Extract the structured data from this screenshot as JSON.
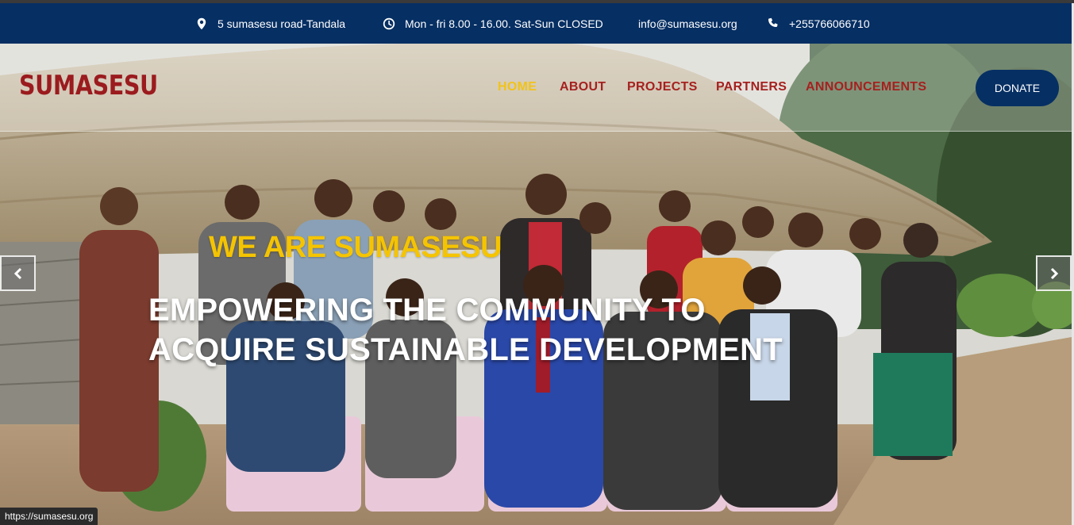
{
  "topbar": {
    "address": "5 sumasesu road-Tandala",
    "hours": "Mon - fri 8.00 - 16.00. Sat-Sun CLOSED",
    "email": "info@sumasesu.org",
    "phone": "+255766066710",
    "icons": {
      "address": "map-pin-icon",
      "hours": "clock-icon",
      "phone": "phone-icon"
    }
  },
  "header": {
    "logo": "SUMASESU",
    "nav": [
      {
        "label": "HOME",
        "active": true
      },
      {
        "label": "ABOUT",
        "active": false
      },
      {
        "label": "PROJECTS",
        "active": false
      },
      {
        "label": "PARTNERS",
        "active": false
      },
      {
        "label": "ANNOUNCEMENTS",
        "active": false
      }
    ],
    "donate_label": "DONATE"
  },
  "hero": {
    "kicker": "WE ARE SUMASESU",
    "headline_line1": "EMPOWERING THE COMMUNITY TO",
    "headline_line2": "ACQUIRE SUSTAINABLE DEVELOPMENT",
    "prev_icon": "chevron-left-icon",
    "next_icon": "chevron-right-icon"
  },
  "status_bar": {
    "url": "https://sumasesu.org"
  },
  "colors": {
    "brand_navy": "#062f63",
    "brand_red": "#9b1b1e",
    "nav_red": "#a5211f",
    "accent_yellow": "#f2c318"
  }
}
